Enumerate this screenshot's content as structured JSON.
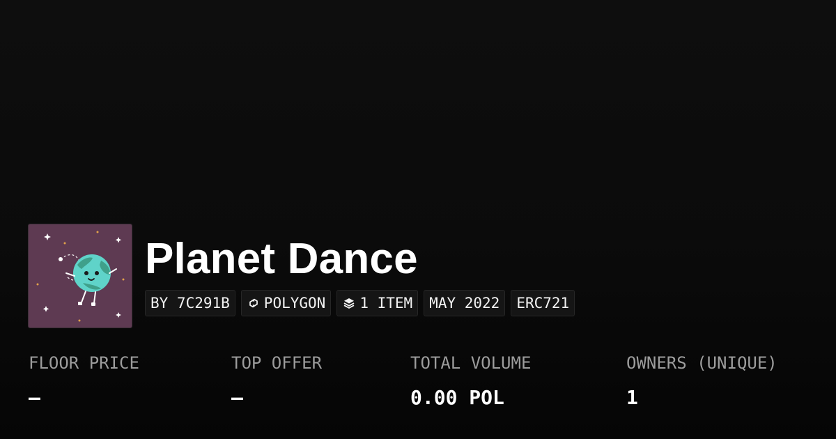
{
  "collection": {
    "name": "Planet Dance",
    "avatar_icon": "planet-dance-artwork",
    "chips": {
      "creator": "BY 7C291B",
      "chain": "POLYGON",
      "chain_icon": "polygon-chain-icon",
      "items": "1 ITEM",
      "items_icon": "layers-icon",
      "date": "MAY 2022",
      "standard": "ERC721"
    }
  },
  "stats": [
    {
      "label": "FLOOR PRICE",
      "value": "—"
    },
    {
      "label": "TOP OFFER",
      "value": "—"
    },
    {
      "label": "TOTAL VOLUME",
      "value": "0.00 POL"
    },
    {
      "label": "OWNERS (UNIQUE)",
      "value": "1"
    }
  ],
  "colors": {
    "background": "#0b0b0b",
    "avatar_background": "#5e3a52",
    "planet_ocean": "#5fd3c9",
    "planet_land": "#3fa08a",
    "label_grey": "#9c9c9c"
  }
}
